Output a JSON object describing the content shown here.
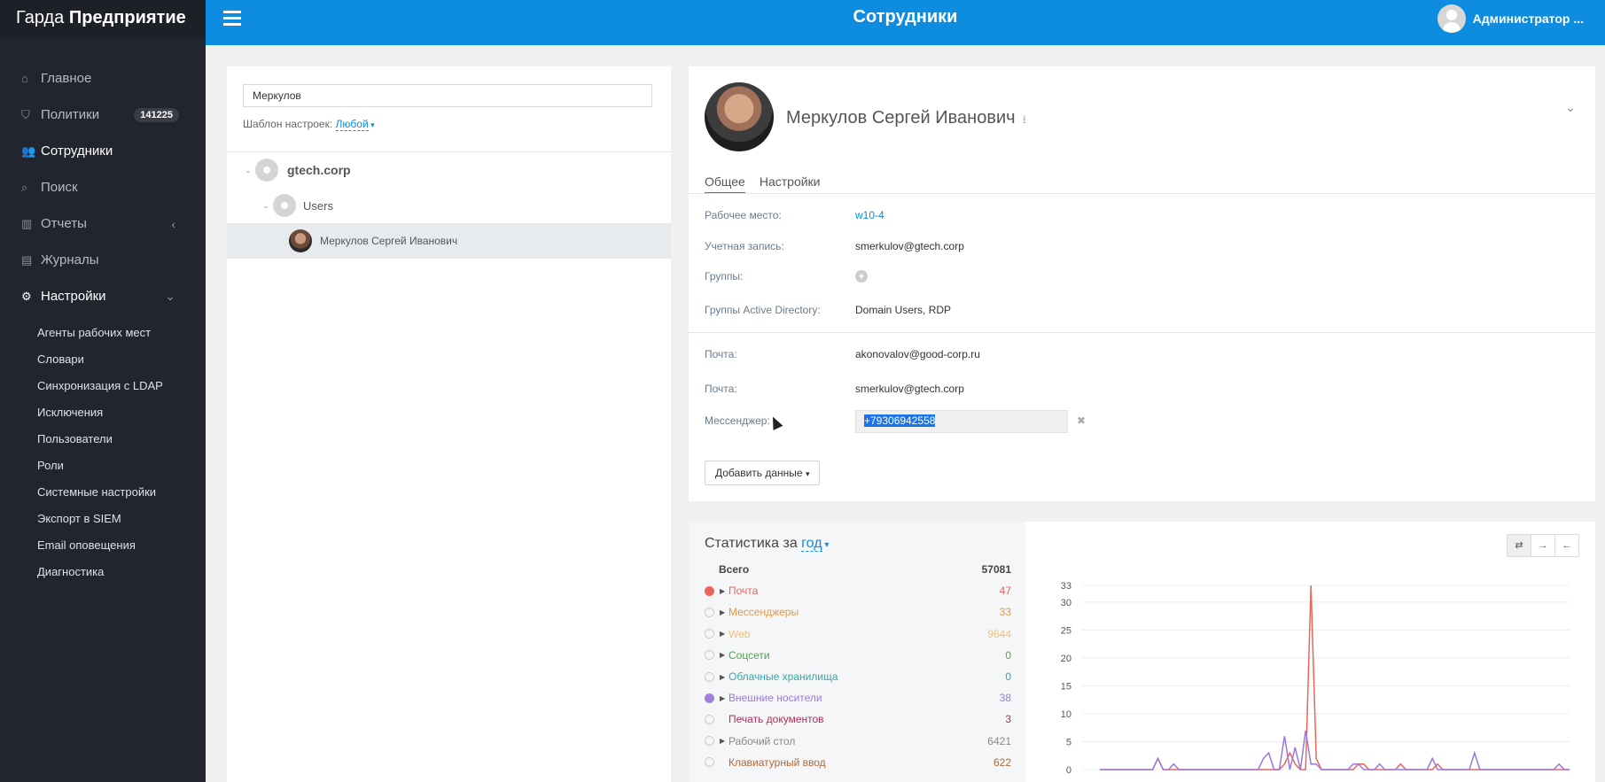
{
  "brand": {
    "light": "Гарда",
    "bold": "Предприятие"
  },
  "header": {
    "title": "Сотрудники",
    "user": "Администратор ..."
  },
  "nav": [
    {
      "label": "Главное",
      "icon": "home-icon",
      "glyph": "⌂"
    },
    {
      "label": "Политики",
      "icon": "shield-icon",
      "glyph": "⛉",
      "badge": "141225"
    },
    {
      "label": "Сотрудники",
      "icon": "users-icon",
      "glyph": "👥"
    },
    {
      "label": "Поиск",
      "icon": "search-icon",
      "glyph": "⌕"
    },
    {
      "label": "Отчеты",
      "icon": "bar-chart-icon",
      "glyph": "▥"
    },
    {
      "label": "Журналы",
      "icon": "book-icon",
      "glyph": "▤"
    },
    {
      "label": "Настройки",
      "icon": "gear-icon",
      "glyph": "⚙"
    }
  ],
  "subnav": [
    "Агенты рабочих мест",
    "Словари",
    "Синхронизация с LDAP",
    "Исключения",
    "Пользователи",
    "Роли",
    "Системные настройки",
    "Экспорт в SIEM",
    "Email оповещения",
    "Диагностика"
  ],
  "left": {
    "search_value": "Меркулов",
    "template_label": "Шаблон настроек:",
    "template_value": "Любой",
    "tree": {
      "domain": "gtech.corp",
      "group": "Users",
      "person": "Меркулов Сергей Иванович"
    }
  },
  "profile": {
    "name": "Меркулов Сергей Иванович",
    "tabs": [
      "Общее",
      "Настройки"
    ],
    "fields": {
      "workplace_label": "Рабочее место:",
      "workplace": "w10-4",
      "account_label": "Учетная запись:",
      "account": "smerkulov@gtech.corp",
      "groups_label": "Группы:",
      "ad_groups_label": "Группы Active Directory:",
      "ad_groups": "Domain Users, RDP",
      "mail1_label": "Почта:",
      "mail1": "akonovalov@good-corp.ru",
      "mail2_label": "Почта:",
      "mail2": "smerkulov@gtech.corp",
      "messenger_label": "Мессенджер:",
      "messenger": "+79306942558"
    },
    "add_button": "Добавить данные"
  },
  "stats": {
    "title": "Статистика за",
    "period": "год",
    "toolbar": [
      "⇄",
      "→",
      "←"
    ],
    "rows": [
      {
        "name": "Всего",
        "value": "57081",
        "color": "#444444",
        "bold": true
      },
      {
        "name": "Почта",
        "value": "47",
        "color": "#e8665a",
        "dot": "#e8665a",
        "expand": true
      },
      {
        "name": "Мессенджеры",
        "value": "33",
        "color": "#e59a48",
        "expand": true
      },
      {
        "name": "Web",
        "value": "9644",
        "color": "#f0c07a",
        "expand": true
      },
      {
        "name": "Соцсети",
        "value": "0",
        "color": "#4ea54a",
        "expand": true
      },
      {
        "name": "Облачные хранилища",
        "value": "0",
        "color": "#3aa6a6",
        "expand": true
      },
      {
        "name": "Внешние носители",
        "value": "38",
        "color": "#9a7ad8",
        "dot": "#a27fdc",
        "expand": true
      },
      {
        "name": "Печать документов",
        "value": "3",
        "color": "#b0305a",
        "expand": false
      },
      {
        "name": "Рабочий стол",
        "value": "6421",
        "color": "#888888",
        "expand": true
      },
      {
        "name": "Клавиатурный ввод",
        "value": "622",
        "color": "#b06a3a",
        "expand": false
      }
    ]
  },
  "chart_data": {
    "type": "line",
    "yticks": [
      0,
      5,
      10,
      15,
      20,
      25,
      30,
      33
    ],
    "ylim": [
      0,
      33
    ],
    "series": [
      {
        "name": "Почта",
        "color": "#e8665a",
        "values": [
          0,
          0,
          0,
          0,
          0,
          0,
          0,
          0,
          0,
          0,
          0,
          2,
          0,
          0,
          0,
          0,
          0,
          0,
          0,
          0,
          0,
          0,
          0,
          0,
          0,
          0,
          0,
          0,
          0,
          0,
          0,
          0,
          0,
          0,
          0,
          1,
          3,
          1,
          0,
          0,
          33,
          2,
          0,
          0,
          0,
          0,
          0,
          0,
          0,
          1,
          1,
          0,
          0,
          0,
          0,
          0,
          0,
          1,
          0,
          0,
          0,
          0,
          0,
          0,
          1,
          0,
          0,
          0,
          0,
          0,
          0,
          0,
          0,
          0,
          0,
          0,
          0,
          0,
          0,
          0,
          0,
          0,
          0,
          0,
          0,
          0,
          0,
          0,
          0,
          0
        ]
      },
      {
        "name": "Внешние носители",
        "color": "#9a7ad8",
        "values": [
          0,
          0,
          0,
          0,
          0,
          0,
          0,
          0,
          0,
          0,
          0,
          2,
          0,
          0,
          1,
          0,
          0,
          0,
          0,
          0,
          0,
          0,
          0,
          0,
          0,
          0,
          0,
          0,
          0,
          0,
          0,
          2,
          3,
          0,
          0,
          6,
          0,
          4,
          0,
          7,
          1,
          1,
          0,
          0,
          0,
          0,
          0,
          0,
          1,
          1,
          0,
          0,
          0,
          1,
          0,
          0,
          0,
          0,
          0,
          0,
          0,
          0,
          0,
          2,
          0,
          0,
          0,
          0,
          0,
          0,
          0,
          3,
          0,
          0,
          0,
          0,
          0,
          0,
          0,
          0,
          0,
          0,
          0,
          0,
          0,
          0,
          0,
          1,
          0,
          0
        ]
      }
    ]
  }
}
